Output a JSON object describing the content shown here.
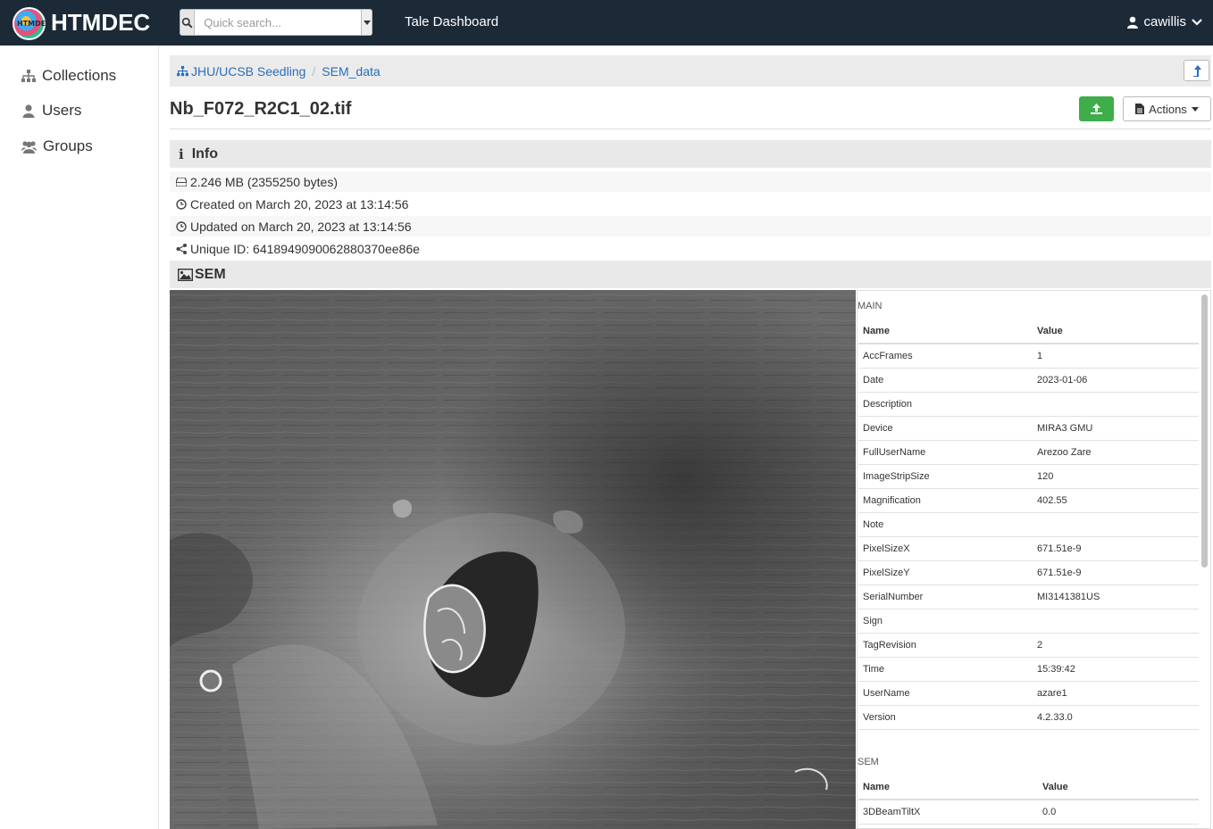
{
  "header": {
    "brand": "HTMDEC",
    "logo_text": "HTMDEC",
    "search_placeholder": "Quick search...",
    "tale_dashboard": "Tale Dashboard",
    "user": "cawillis"
  },
  "sidebar": {
    "items": [
      {
        "label": "Collections",
        "icon": "sitemap-icon"
      },
      {
        "label": "Users",
        "icon": "user-icon"
      },
      {
        "label": "Groups",
        "icon": "users-icon"
      }
    ]
  },
  "breadcrumb": {
    "root": "JHU/UCSB Seedling",
    "folder": "SEM_data",
    "separator": "/"
  },
  "item": {
    "title": "Nb_F072_R2C1_02.tif",
    "actions_label": "Actions"
  },
  "info": {
    "heading": "Info",
    "size": "2.246 MB (2355250 bytes)",
    "created": "Created on March 20, 2023 at 13:14:56",
    "updated": "Updated on March 20, 2023 at 13:14:56",
    "unique_id": "Unique ID: 6418949090062880370ee86e"
  },
  "sem": {
    "heading": "SEM",
    "main_section": "MAIN",
    "sem_section": "SEM",
    "col_name": "Name",
    "col_value": "Value",
    "main_rows": [
      {
        "name": "AccFrames",
        "value": "1"
      },
      {
        "name": "Date",
        "value": "2023-01-06"
      },
      {
        "name": "Description",
        "value": ""
      },
      {
        "name": "Device",
        "value": "MIRA3 GMU"
      },
      {
        "name": "FullUserName",
        "value": "Arezoo Zare"
      },
      {
        "name": "ImageStripSize",
        "value": "120"
      },
      {
        "name": "Magnification",
        "value": "402.55"
      },
      {
        "name": "Note",
        "value": ""
      },
      {
        "name": "PixelSizeX",
        "value": "671.51e-9"
      },
      {
        "name": "PixelSizeY",
        "value": "671.51e-9"
      },
      {
        "name": "SerialNumber",
        "value": "MI3141381US"
      },
      {
        "name": "Sign",
        "value": ""
      },
      {
        "name": "TagRevision",
        "value": "2"
      },
      {
        "name": "Time",
        "value": "15:39:42"
      },
      {
        "name": "UserName",
        "value": "azare1"
      },
      {
        "name": "Version",
        "value": "4.2.33.0"
      }
    ],
    "sem_rows": [
      {
        "name": "3DBeamTiltX",
        "value": "0.0"
      }
    ]
  },
  "colors": {
    "topbar": "#1c2a38",
    "link": "#2a6ebb",
    "upload_green": "#3fae4a"
  }
}
